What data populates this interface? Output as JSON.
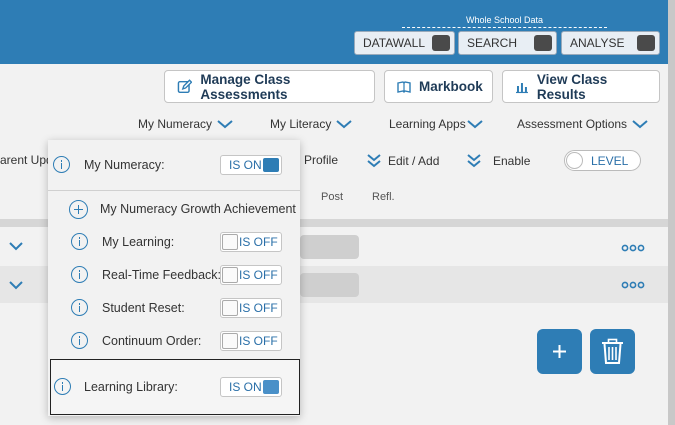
{
  "header": {
    "whole_school_label": "Whole School Data",
    "datawall": "DATAWALL",
    "search": "SEARCH",
    "analyse": "ANALYSE"
  },
  "actions": {
    "manage": "Manage Class Assessments",
    "markbook": "Markbook",
    "view_results": "View Class Results"
  },
  "nav": {
    "my_numeracy": "My Numeracy",
    "my_literacy": "My Literacy",
    "learning_apps": "Learning Apps",
    "assessment_options": "Assessment Options"
  },
  "toolbar": {
    "parent_upd": "arent Upd",
    "profile": "Profile",
    "edit_add": "Edit / Add",
    "enable": "Enable",
    "level": "LEVEL"
  },
  "columns": {
    "post": "Post",
    "refl": "Refl."
  },
  "popup": {
    "my_numeracy_label": "My Numeracy:",
    "my_numeracy_state": "IS ON",
    "growth_label": "My Numeracy Growth Achievement",
    "my_learning_label": "My Learning:",
    "my_learning_state": "IS OFF",
    "rtf_label": "Real-Time Feedback:",
    "rtf_state": "IS OFF",
    "reset_label": "Student Reset:",
    "reset_state": "IS OFF",
    "continuum_label": "Continuum Order:",
    "continuum_state": "IS OFF",
    "library_label": "Learning Library:",
    "library_state": "IS ON"
  },
  "colors": {
    "brand": "#2e7db5",
    "toggle_text": "#2a6fa8"
  }
}
